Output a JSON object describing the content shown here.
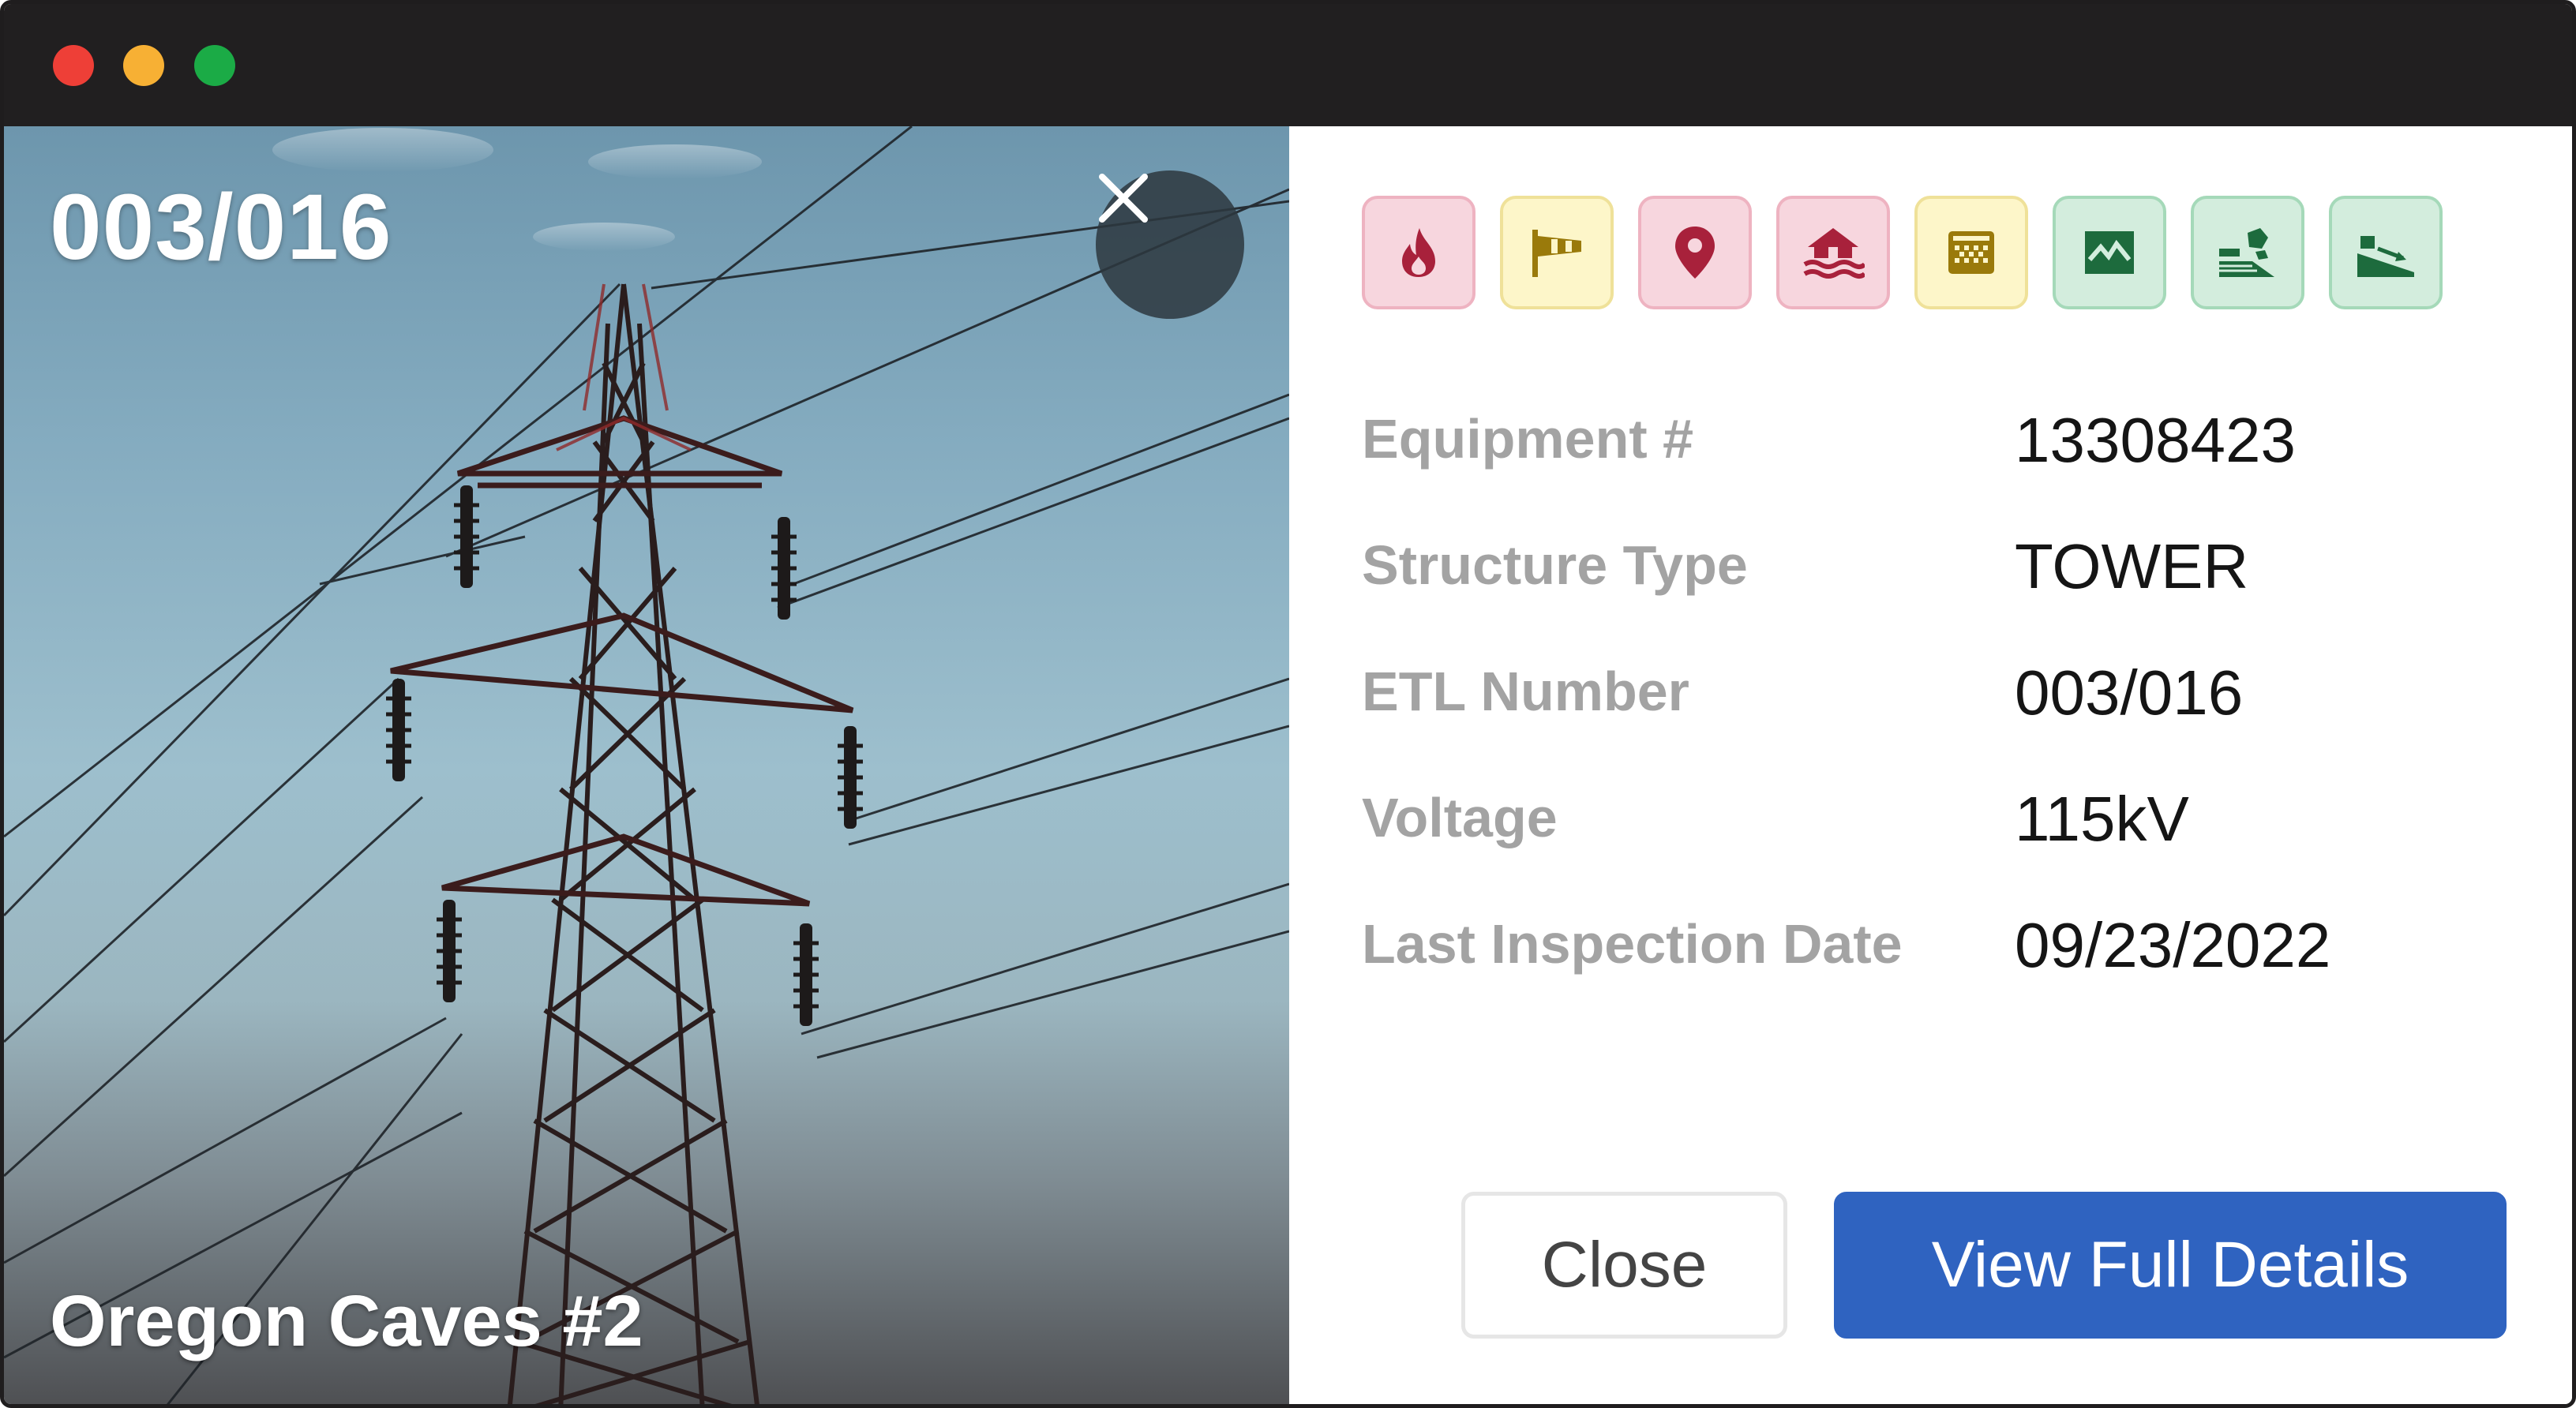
{
  "window": {
    "controls": [
      "close-dot",
      "minimize-dot",
      "zoom-dot"
    ],
    "colors": {
      "close": "#ee3f37",
      "minimize": "#f7b034",
      "zoom": "#1bab46",
      "titlebar": "#211f20"
    }
  },
  "photo": {
    "code": "003/016",
    "name": "Oregon Caves #2",
    "close_icon": "close-icon"
  },
  "badges": [
    {
      "icon": "fire-icon",
      "tone": "red"
    },
    {
      "icon": "windsock-icon",
      "tone": "yellow"
    },
    {
      "icon": "location-pin-icon",
      "tone": "red"
    },
    {
      "icon": "flood-icon",
      "tone": "red"
    },
    {
      "icon": "grid-sensor-icon",
      "tone": "yellow"
    },
    {
      "icon": "landscape-icon",
      "tone": "green"
    },
    {
      "icon": "rockfall-icon",
      "tone": "green"
    },
    {
      "icon": "landslide-icon",
      "tone": "green"
    }
  ],
  "colors": {
    "red_icon": "#a8213b",
    "yellow_icon": "#9a7a0b",
    "green_icon": "#1d6b3d",
    "primary": "#2f63c0"
  },
  "fields": [
    {
      "label": "Equipment #",
      "value": "13308423"
    },
    {
      "label": "Structure Type",
      "value": "TOWER"
    },
    {
      "label": "ETL Number",
      "value": "003/016"
    },
    {
      "label": "Voltage",
      "value": "115kV"
    },
    {
      "label": "Last Inspection Date",
      "value": "09/23/2022"
    }
  ],
  "actions": {
    "close_label": "Close",
    "view_label": "View Full Details"
  }
}
